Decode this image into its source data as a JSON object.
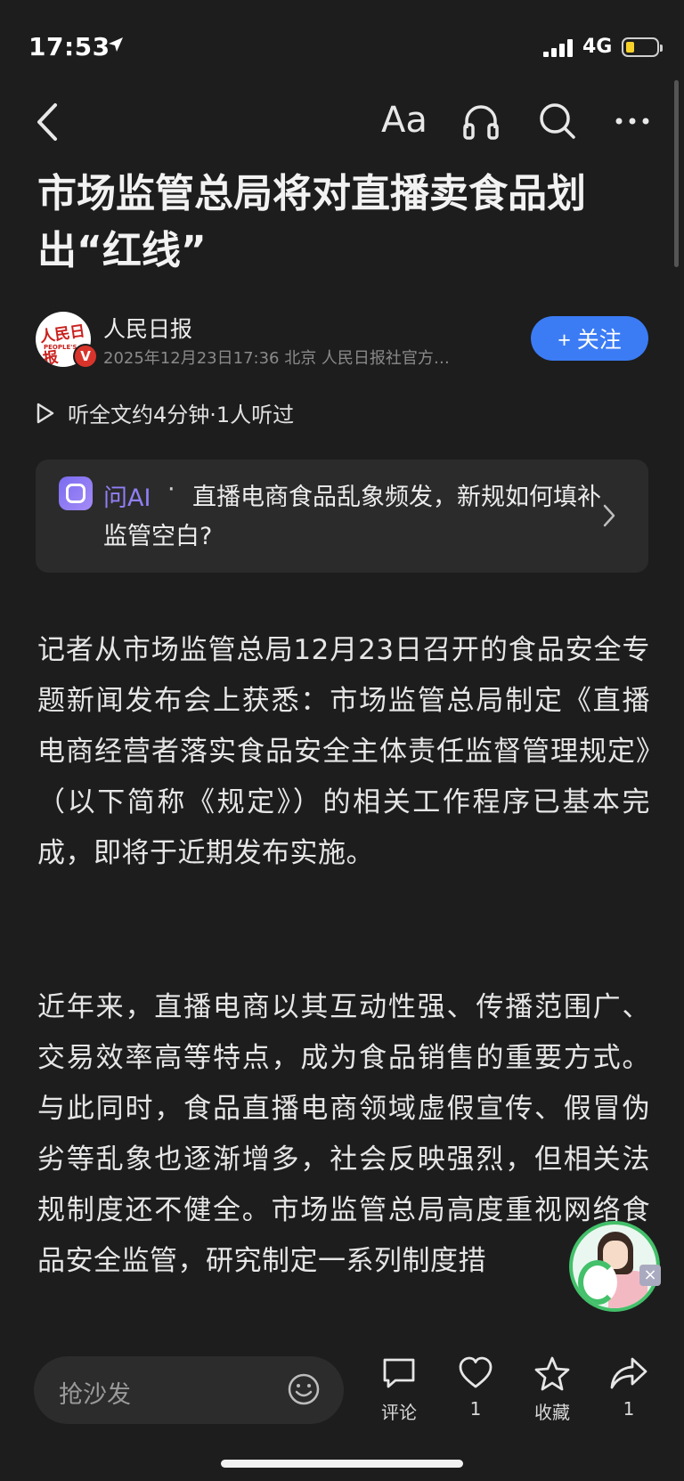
{
  "status_bar": {
    "time": "17:53",
    "network": "4G",
    "battery_level": 0.2
  },
  "nav": {
    "font_size_label": "Aa"
  },
  "article": {
    "title": "市场监管总局将对直播卖食品划出“红线”",
    "author": {
      "name": "人民日报",
      "meta": "2025年12月23日17:36 北京 人民日报社官方…",
      "avatar_text": "人民日报",
      "avatar_subtext": "PEOPLE'S",
      "verified_mark": "V"
    },
    "follow_label": "+ 关注",
    "listen": "听全文约4分钟·1人听过",
    "ask_ai": {
      "label": "问AI",
      "separator": "·",
      "question": "直播电商食品乱象频发，新规如何填补监管空白?"
    },
    "paragraphs": [
      "记者从市场监管总局12月23日召开的食品安全专题新闻发布会上获悉：市场监管总局制定《直播电商经营者落实食品安全主体责任监督管理规定》（以下简称《规定》）的相关工作程序已基本完成，即将于近期发布实施。",
      "近年来，直播电商以其互动性强、传播范围广、交易效率高等特点，成为食品销售的重要方式。与此同时，食品直播电商领域虚假宣传、假冒伪劣等乱象也逐渐增多，社会反映强烈，但相关法规制度还不健全。市场监管总局高度重视网络食品安全监管，研究制定一系列制度措"
    ]
  },
  "floating_assistant": {
    "close": "×"
  },
  "bottom_bar": {
    "comment_placeholder": "抢沙发",
    "actions": [
      {
        "label": "评论",
        "icon": "comment-icon"
      },
      {
        "label": "1",
        "icon": "heart-icon"
      },
      {
        "label": "收藏",
        "icon": "star-icon"
      },
      {
        "label": "1",
        "icon": "share-icon"
      }
    ]
  },
  "colors": {
    "background": "#1d1d1d",
    "accent_blue": "#3b7cf5",
    "ai_purple": "#8f7ff5"
  }
}
